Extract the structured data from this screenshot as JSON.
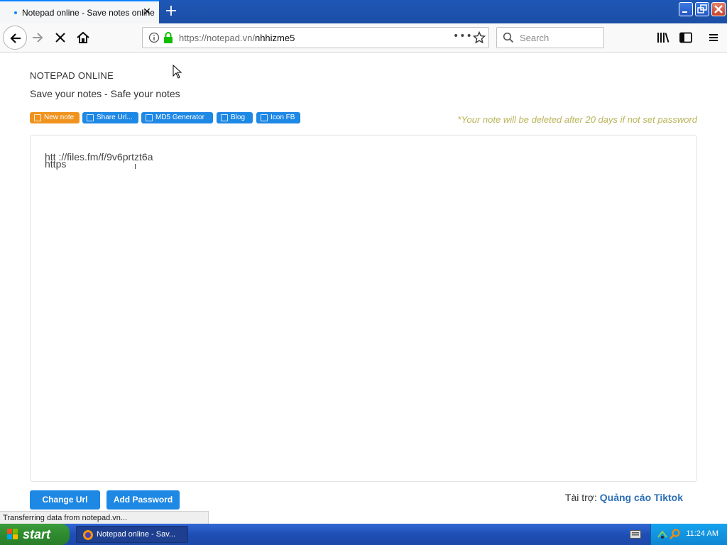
{
  "browser": {
    "tab": {
      "title": "Notepad online - Save notes online"
    },
    "url": {
      "base": "https://notepad.vn/",
      "path": "nhhizme5"
    },
    "search_placeholder": "Search"
  },
  "page": {
    "app_title": "NOTEPAD ONLINE",
    "subtitle": "Save your notes - Safe your notes",
    "nav_pills": [
      {
        "label": "New note",
        "color": "#f0931e"
      },
      {
        "label": "Share Url...",
        "color": "#1e88e5"
      },
      {
        "label": "MD5 Generator",
        "color": "#1e88e5"
      },
      {
        "label": "Blog",
        "color": "#1e88e5"
      },
      {
        "label": "Icon FB",
        "color": "#1e88e5"
      }
    ],
    "warning": "*Your note will be deleted after 20 days if not set password",
    "note": {
      "line1": "htt   ://files.fm/f/9v6prtzt6a",
      "line2": "https"
    },
    "buttons": {
      "change_url": "Change Url",
      "add_password": "Add Password"
    },
    "sponsor": {
      "label": "Tài trợ:",
      "link": "Quảng cáo Tiktok"
    }
  },
  "statusbar": {
    "text": "Transferring data from notepad.vn..."
  },
  "taskbar": {
    "start": "start",
    "task_label": "Notepad online - Sav...",
    "clock": "11:24 AM"
  }
}
